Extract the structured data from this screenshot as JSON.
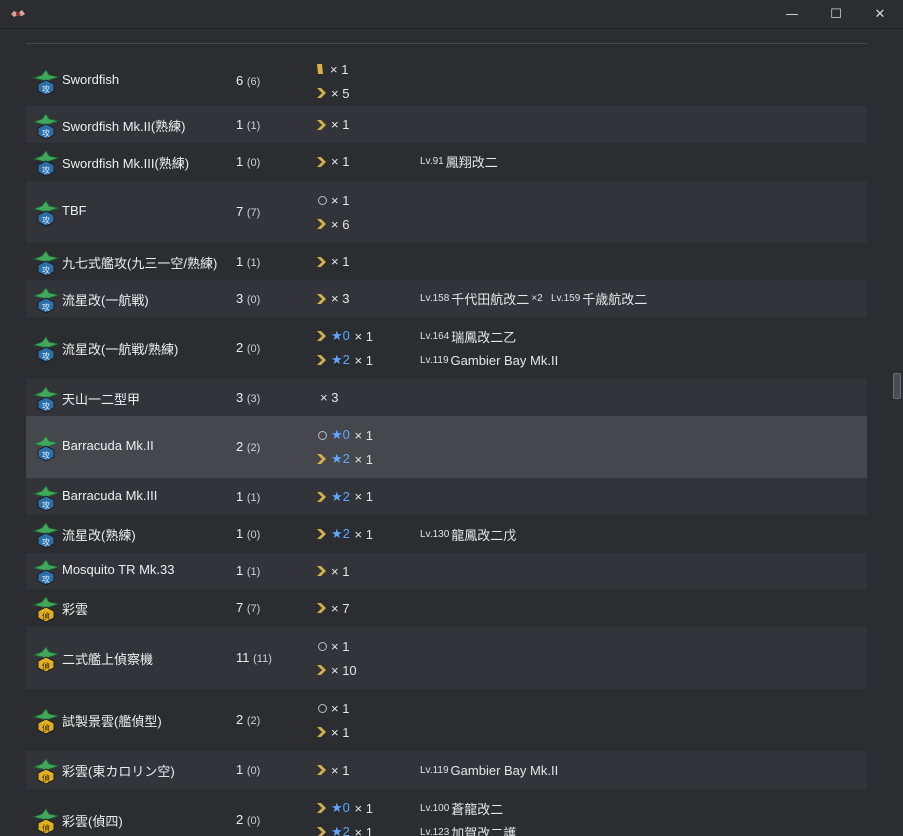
{
  "window": {
    "minimize_glyph": "—",
    "maximize_glyph": "☐",
    "close_glyph": "✕"
  },
  "colors": {
    "background": "#2b2d31",
    "row_alt": "#32343a",
    "row_highlight": "#45474d",
    "star": "#5fa8ff",
    "chevron": "#d4b04a",
    "attack_badge": "#2f6fa8",
    "recon_badge": "#e0b020"
  },
  "rows": [
    {
      "name": "Swordfish",
      "count": "6",
      "count_sub": "(6)",
      "icon": "torpedo-bomber-icon",
      "bg": "",
      "stars": [
        {
          "prof": "proficiency-bar-icon",
          "star": "",
          "mult": "× 1"
        },
        {
          "prof": "chevron-icon",
          "star": "",
          "mult": "× 5"
        }
      ],
      "ships": []
    },
    {
      "name": "Swordfish Mk.II(熟練)",
      "count": "1",
      "count_sub": "(1)",
      "icon": "torpedo-bomber-icon",
      "bg": "alt",
      "stars": [
        {
          "prof": "chevron-icon",
          "star": "",
          "mult": "× 1"
        }
      ],
      "ships": []
    },
    {
      "name": "Swordfish Mk.III(熟練)",
      "count": "1",
      "count_sub": "(0)",
      "icon": "torpedo-bomber-icon",
      "bg": "",
      "stars": [
        {
          "prof": "chevron-icon",
          "star": "",
          "mult": "× 1"
        }
      ],
      "ships": [
        [
          {
            "lv": "Lv.91",
            "name": "鳳翔改二",
            "mult": ""
          }
        ]
      ]
    },
    {
      "name": "TBF",
      "count": "7",
      "count_sub": "(7)",
      "icon": "torpedo-bomber-icon",
      "bg": "alt",
      "stars": [
        {
          "prof": "circle-icon",
          "star": "",
          "mult": "× 1"
        },
        {
          "prof": "chevron-icon",
          "star": "",
          "mult": "× 6"
        }
      ],
      "ships": []
    },
    {
      "name": "九七式艦攻(九三一空/熟練)",
      "count": "1",
      "count_sub": "(1)",
      "icon": "torpedo-bomber-icon",
      "bg": "",
      "stars": [
        {
          "prof": "chevron-icon",
          "star": "",
          "mult": "× 1"
        }
      ],
      "ships": []
    },
    {
      "name": "流星改(一航戦)",
      "count": "3",
      "count_sub": "(0)",
      "icon": "torpedo-bomber-icon",
      "bg": "alt",
      "stars": [
        {
          "prof": "chevron-icon",
          "star": "",
          "mult": "× 3"
        }
      ],
      "ships": [
        [
          {
            "lv": "Lv.158",
            "name": "千代田航改二",
            "mult": "×2"
          },
          {
            "lv": "Lv.159",
            "name": "千歳航改二",
            "mult": ""
          }
        ]
      ]
    },
    {
      "name": "流星改(一航戦/熟練)",
      "count": "2",
      "count_sub": "(0)",
      "icon": "torpedo-bomber-icon",
      "bg": "",
      "stars": [
        {
          "prof": "chevron-icon",
          "star": "★0",
          "mult": "× 1"
        },
        {
          "prof": "chevron-icon",
          "star": "★2",
          "mult": "× 1"
        }
      ],
      "ships": [
        [
          {
            "lv": "Lv.164",
            "name": "瑞鳳改二乙",
            "mult": ""
          }
        ],
        [
          {
            "lv": "Lv.119",
            "name": "Gambier Bay Mk.II",
            "mult": ""
          }
        ]
      ]
    },
    {
      "name": "天山一二型甲",
      "count": "3",
      "count_sub": "(3)",
      "icon": "torpedo-bomber-icon",
      "bg": "alt",
      "stars": [
        {
          "prof": "",
          "star": "",
          "mult": "× 3"
        }
      ],
      "ships": []
    },
    {
      "name": "Barracuda Mk.II",
      "count": "2",
      "count_sub": "(2)",
      "icon": "torpedo-bomber-icon",
      "bg": "hl",
      "stars": [
        {
          "prof": "circle-icon",
          "star": "★0",
          "mult": "× 1"
        },
        {
          "prof": "chevron-icon",
          "star": "★2",
          "mult": "× 1"
        }
      ],
      "ships": []
    },
    {
      "name": "Barracuda Mk.III",
      "count": "1",
      "count_sub": "(1)",
      "icon": "torpedo-bomber-icon",
      "bg": "alt",
      "stars": [
        {
          "prof": "chevron-icon",
          "star": "★2",
          "mult": "× 1"
        }
      ],
      "ships": []
    },
    {
      "name": "流星改(熟練)",
      "count": "1",
      "count_sub": "(0)",
      "icon": "torpedo-bomber-icon",
      "bg": "",
      "stars": [
        {
          "prof": "chevron-icon",
          "star": "★2",
          "mult": "× 1"
        }
      ],
      "ships": [
        [
          {
            "lv": "Lv.130",
            "name": "龍鳳改二戊",
            "mult": ""
          }
        ]
      ]
    },
    {
      "name": "Mosquito TR Mk.33",
      "count": "1",
      "count_sub": "(1)",
      "icon": "torpedo-bomber-icon",
      "bg": "alt",
      "stars": [
        {
          "prof": "chevron-icon",
          "star": "",
          "mult": "× 1"
        }
      ],
      "ships": []
    },
    {
      "name": "彩雲",
      "count": "7",
      "count_sub": "(7)",
      "icon": "recon-plane-icon",
      "bg": "",
      "stars": [
        {
          "prof": "chevron-icon",
          "star": "",
          "mult": "× 7"
        }
      ],
      "ships": []
    },
    {
      "name": "二式艦上偵察機",
      "count": "11",
      "count_sub": "(11)",
      "icon": "recon-plane-icon",
      "bg": "alt",
      "stars": [
        {
          "prof": "circle-icon",
          "star": "",
          "mult": "× 1"
        },
        {
          "prof": "chevron-icon",
          "star": "",
          "mult": "× 10"
        }
      ],
      "ships": []
    },
    {
      "name": "試製景雲(艦偵型)",
      "count": "2",
      "count_sub": "(2)",
      "icon": "recon-plane-icon",
      "bg": "",
      "stars": [
        {
          "prof": "circle-icon",
          "star": "",
          "mult": "× 1"
        },
        {
          "prof": "chevron-icon",
          "star": "",
          "mult": "× 1"
        }
      ],
      "ships": []
    },
    {
      "name": "彩雲(東カロリン空)",
      "count": "1",
      "count_sub": "(0)",
      "icon": "recon-plane-icon",
      "bg": "alt",
      "stars": [
        {
          "prof": "chevron-icon",
          "star": "",
          "mult": "× 1"
        }
      ],
      "ships": [
        [
          {
            "lv": "Lv.119",
            "name": "Gambier Bay Mk.II",
            "mult": ""
          }
        ]
      ]
    },
    {
      "name": "彩雲(偵四)",
      "count": "2",
      "count_sub": "(0)",
      "icon": "recon-plane-icon",
      "bg": "",
      "stars": [
        {
          "prof": "chevron-icon",
          "star": "★0",
          "mult": "× 1"
        },
        {
          "prof": "chevron-icon",
          "star": "★2",
          "mult": "× 1"
        }
      ],
      "ships": [
        [
          {
            "lv": "Lv.100",
            "name": "蒼龍改二",
            "mult": ""
          }
        ],
        [
          {
            "lv": "Lv.123",
            "name": "加賀改二護",
            "mult": ""
          }
        ]
      ]
    }
  ]
}
